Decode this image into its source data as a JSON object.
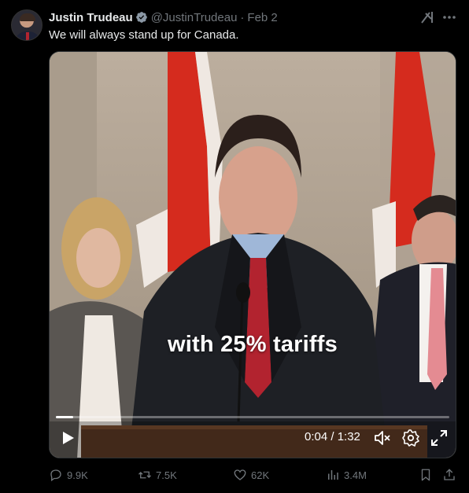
{
  "tweet": {
    "author_name": "Justin Trudeau",
    "handle": "@JustinTrudeau",
    "separator": "·",
    "date": "Feb 2",
    "text": "We will always stand up for Canada.",
    "verified_icon": "verified-badge-icon"
  },
  "video": {
    "caption": "with 25% tariffs",
    "time_display": "0:04 / 1:32",
    "progress_fraction": 0.044
  },
  "actions": {
    "replies": "9.9K",
    "reposts": "7.5K",
    "likes": "62K",
    "views": "3.4M"
  },
  "colors": {
    "background": "#000000",
    "text": "#e7e9ea",
    "muted": "#71767b",
    "verified": "#8b98a5"
  }
}
